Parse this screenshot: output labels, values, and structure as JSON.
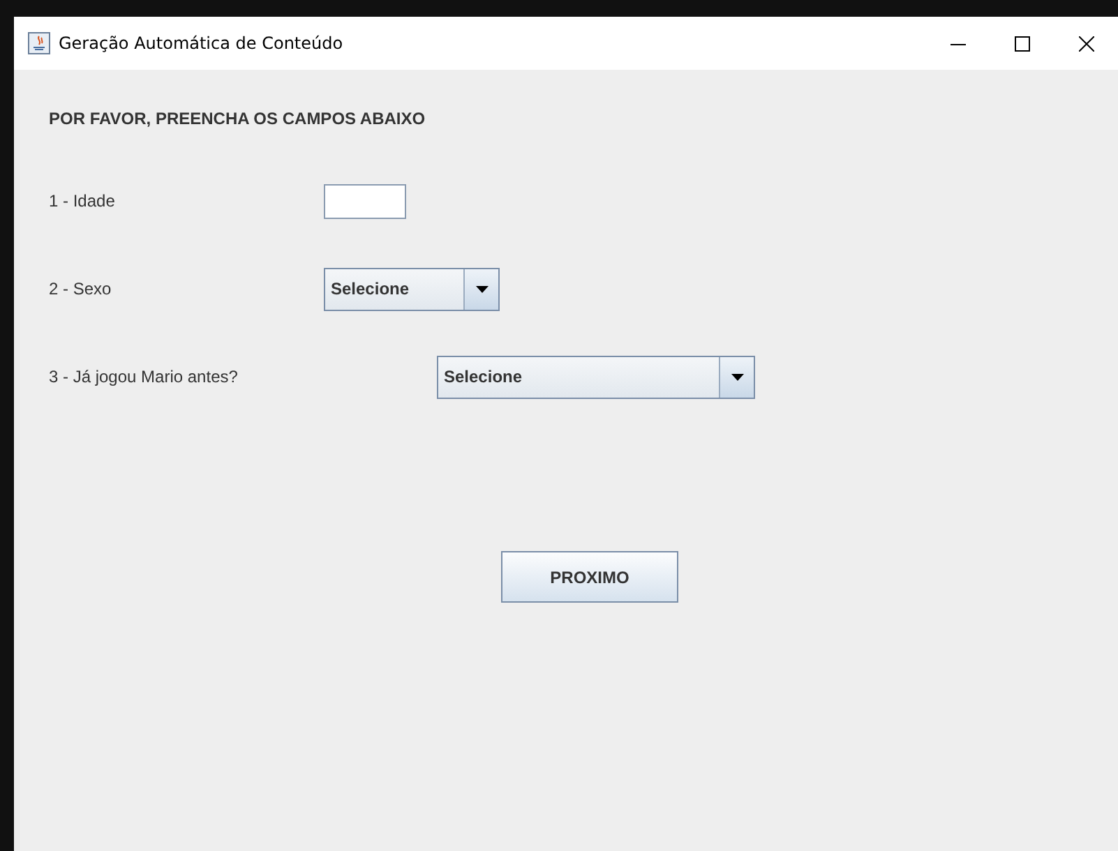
{
  "window": {
    "title": "Geração Automática de Conteúdo"
  },
  "heading": "POR FAVOR, PREENCHA OS CAMPOS ABAIXO",
  "fields": [
    {
      "kind": "text",
      "label": "1 - Idade"
    },
    {
      "kind": "select",
      "label": "2 - Sexo",
      "value": "Selecione"
    },
    {
      "kind": "select",
      "label": "3 - Já jogou Mario antes?",
      "value": "Selecione"
    }
  ],
  "button": "PROXIMO"
}
